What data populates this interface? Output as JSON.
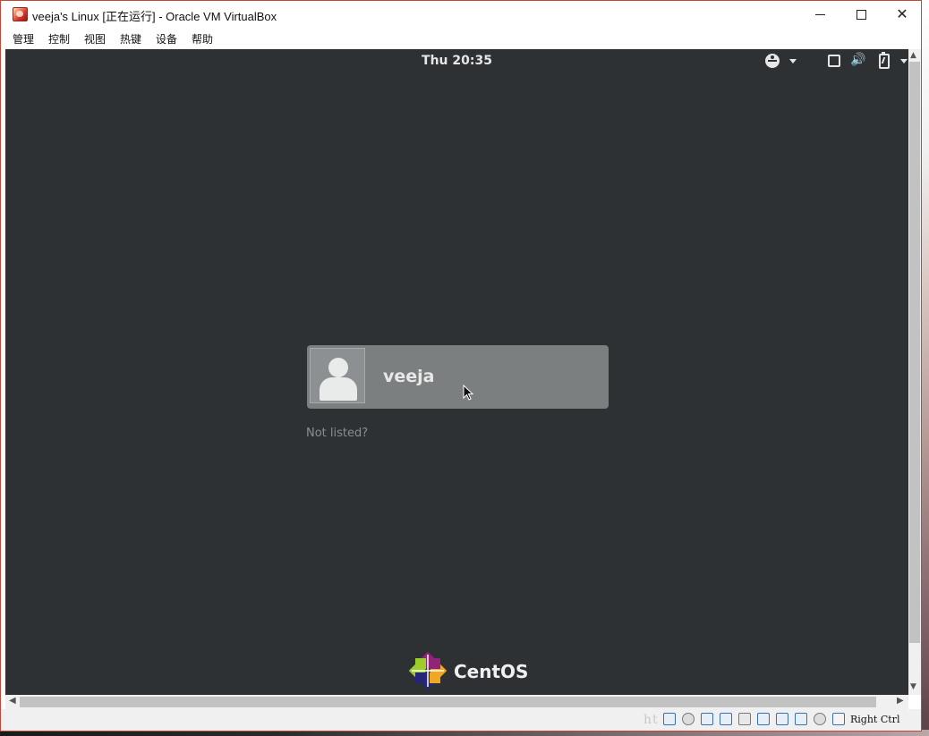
{
  "window": {
    "title": "veeja's Linux [正在运行] - Oracle VM VirtualBox",
    "minimize_glyph": "",
    "close_glyph": "✕"
  },
  "menu": [
    "管理",
    "控制",
    "视图",
    "热键",
    "设备",
    "帮助"
  ],
  "guest": {
    "clock": "Thu 20:35",
    "icons": [
      "accessibility-icon",
      "screen-icon",
      "volume-icon",
      "battery-icon"
    ],
    "volume_glyph": "🔊",
    "user_name": "veeja",
    "not_listed": "Not listed?",
    "brand": "CentOS"
  },
  "statusbar": {
    "host_key": "Right Ctrl",
    "watermark_prefix": "ht"
  },
  "colors": {
    "guest_background": "#2e3133",
    "user_card": "#7c7f80",
    "title_accent": "#c4473a"
  }
}
